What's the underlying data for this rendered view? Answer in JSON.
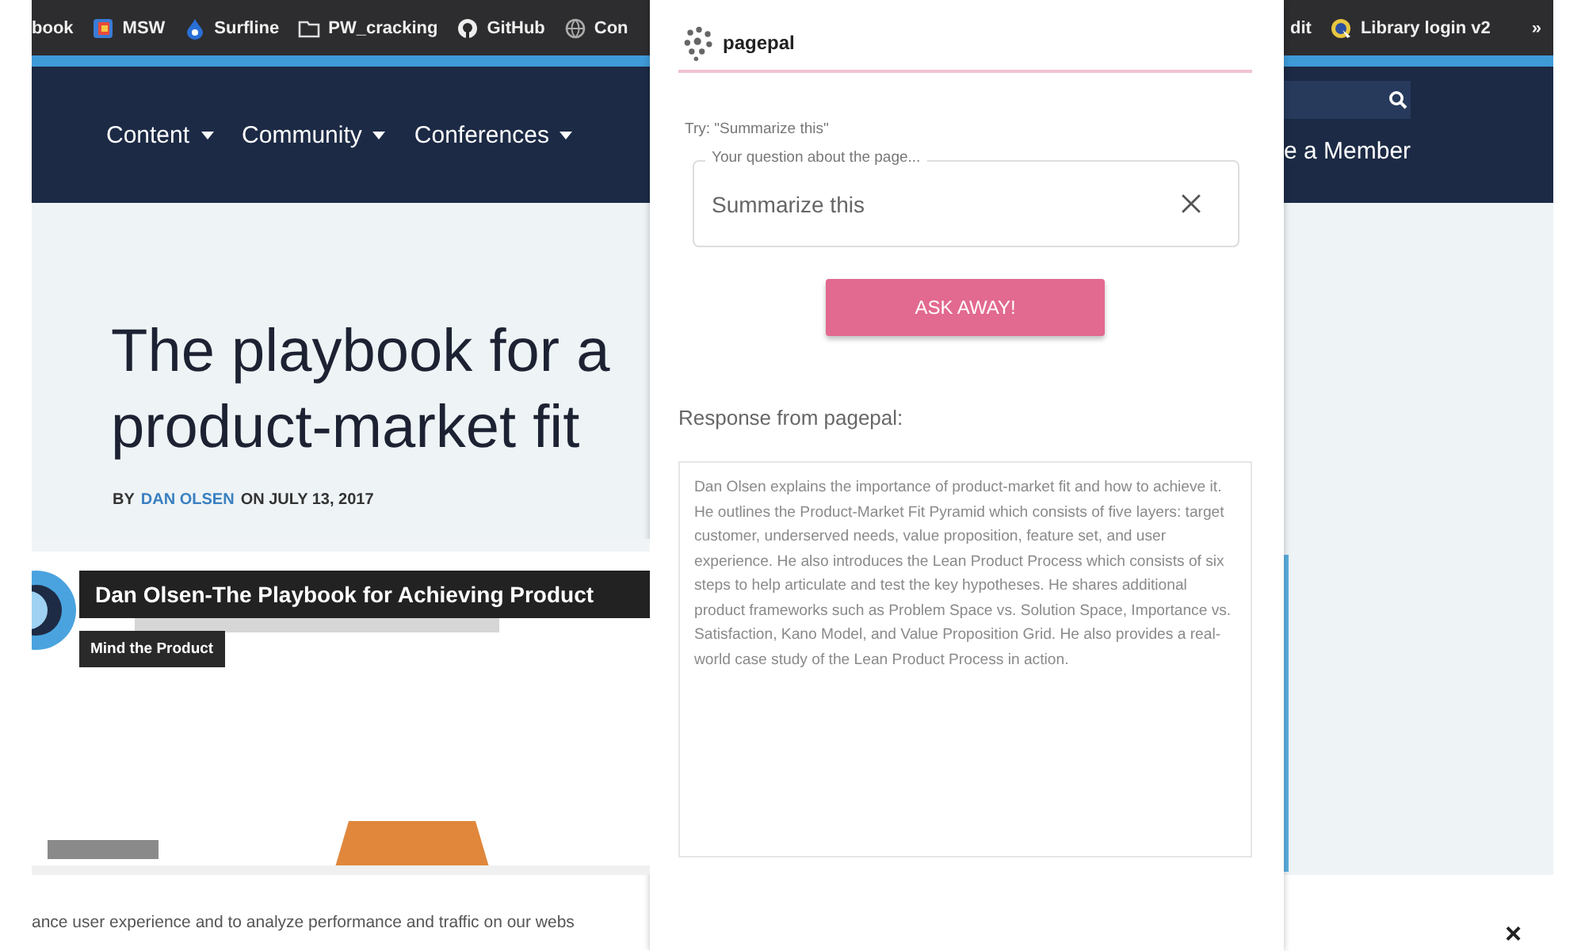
{
  "bookmarks_bar": {
    "left_items": [
      {
        "label": "book",
        "kind": "plain"
      },
      {
        "label": "MSW",
        "kind": "app"
      },
      {
        "label": "Surfline",
        "kind": "drop"
      },
      {
        "label": "PW_cracking",
        "kind": "folder"
      },
      {
        "label": "GitHub",
        "kind": "github"
      },
      {
        "label": "Con",
        "kind": "globe"
      }
    ],
    "right_items": [
      {
        "label": "dit",
        "kind": "plain"
      },
      {
        "label": "Library login v2",
        "kind": "app"
      }
    ],
    "overflow": "»"
  },
  "site_nav": {
    "menus": [
      {
        "label": "Content"
      },
      {
        "label": "Community"
      },
      {
        "label": "Conferences"
      }
    ],
    "right_label": "e a Member"
  },
  "article": {
    "title_lines": [
      "The playbook for a",
      "product-market fit"
    ],
    "byline_prefix": "BY",
    "author": "DAN OLSEN",
    "byline_suffix": "ON JULY 13, 2017"
  },
  "video": {
    "kind": "picture",
    "title": "Dan Olsen-The Playbook for Achieving Product",
    "channel": "Mind the Product"
  },
  "cookie_banner": {
    "text": "ance user experience and to analyze performance and traffic on our webs",
    "close": "×"
  },
  "pagepal": {
    "name": "pagepal",
    "hint": "Try: \"Summarize this\"",
    "question_field": {
      "label": "Your question about the page...",
      "value": "Summarize this"
    },
    "button": "ASK AWAY!",
    "response_label": "Response from pagepal:",
    "response": "Dan Olsen explains the importance of product-market fit and how to achieve it. He outlines the Product-Market Fit Pyramid which consists of five layers: target customer, underserved needs, value proposition, feature set, and user experience. He also introduces the Lean Product Process which consists of six steps to help articulate and test the key hypotheses. He shares additional product frameworks such as Problem Space vs. Solution Space, Importance vs. Satisfaction, Kano Model, and Value Proposition Grid. He also provides a real-world case study of the Lean Product Process in action."
  }
}
